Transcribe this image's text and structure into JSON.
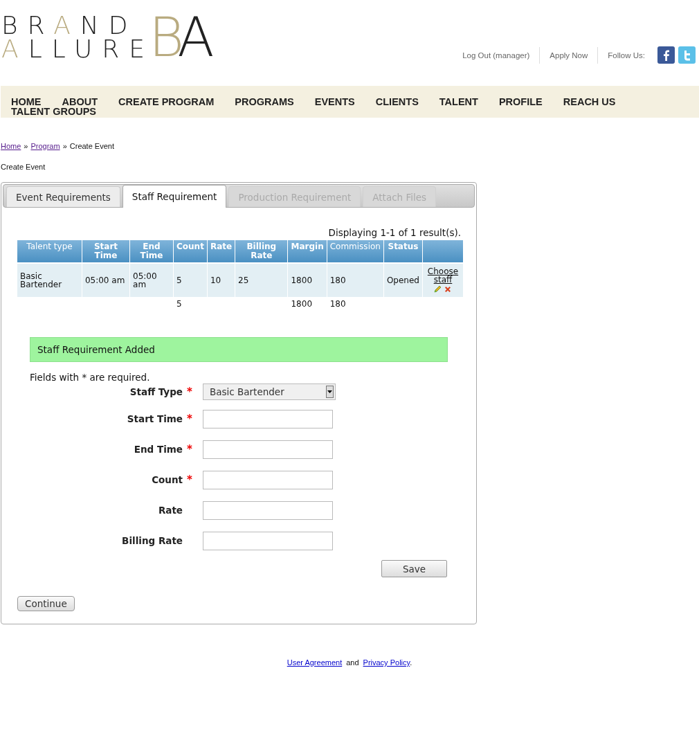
{
  "logo": {
    "lines": [
      [
        {
          "text": "BR",
          "accent": false
        },
        {
          "text": "A",
          "accent": true
        },
        {
          "text": "ND",
          "accent": false
        }
      ],
      [
        {
          "text": "A",
          "accent": true
        },
        {
          "text": "LLURE",
          "accent": false
        }
      ]
    ],
    "monogram": [
      {
        "text": "B",
        "accent": true
      },
      {
        "text": "A",
        "accent": false
      }
    ]
  },
  "top_links": [
    "Log Out (manager)",
    "Apply Now"
  ],
  "follow_label": "Follow Us:",
  "nav": [
    "HOME",
    "ABOUT",
    "CREATE PROGRAM",
    "PROGRAMS",
    "EVENTS",
    "CLIENTS",
    "TALENT",
    "PROFILE",
    "REACH US",
    "TALENT GROUPS"
  ],
  "breadcrumb": {
    "links": [
      "Home",
      "Program"
    ],
    "separator": "»",
    "current": "Create Event"
  },
  "page_title": "Create Event",
  "tabs": [
    {
      "label": "Event Requirements",
      "selected": false,
      "disabled": false
    },
    {
      "label": "Staff Requirement",
      "selected": true,
      "disabled": false
    },
    {
      "label": "Production Requirement",
      "selected": false,
      "disabled": true
    },
    {
      "label": "Attach Files",
      "selected": false,
      "disabled": true
    }
  ],
  "summary": "Displaying 1-1 of 1 result(s).",
  "table": {
    "columns": [
      {
        "label": "Talent type",
        "sortable": false
      },
      {
        "label": "Start Time",
        "sortable": true
      },
      {
        "label": "End Time",
        "sortable": true
      },
      {
        "label": "Count",
        "sortable": true,
        "total": "5"
      },
      {
        "label": "Rate",
        "sortable": true
      },
      {
        "label": "Billing Rate",
        "sortable": true
      },
      {
        "label": "Margin",
        "sortable": true,
        "total": "1800"
      },
      {
        "label": "Commission",
        "sortable": false,
        "total": "180"
      },
      {
        "label": "Status",
        "sortable": true
      }
    ],
    "rows": [
      {
        "cells": [
          "Basic Bartender",
          "05:00 am",
          "05:00 am",
          "5",
          "10",
          "25",
          "1800",
          "180",
          "Opened"
        ],
        "action_link": "Choose staff"
      }
    ],
    "totals_row": true
  },
  "flash": "Staff Requirement Added",
  "required_note": "Fields with * are required.",
  "required_mark": "*",
  "fields": [
    {
      "label": "Staff Type",
      "required": true,
      "kind": "select",
      "value": "Basic Bartender"
    },
    {
      "label": "Start Time",
      "required": true,
      "kind": "text"
    },
    {
      "label": "End Time",
      "required": true,
      "kind": "text"
    },
    {
      "label": "Count",
      "required": true,
      "kind": "text"
    },
    {
      "label": "Rate",
      "required": false,
      "kind": "text"
    },
    {
      "label": "Billing Rate",
      "required": false,
      "kind": "text"
    }
  ],
  "save_button": "Save",
  "continue_button": "Continue",
  "footer": {
    "links": [
      "User Agreement",
      "Privacy Policy"
    ],
    "joiner": "and",
    "end": "."
  }
}
